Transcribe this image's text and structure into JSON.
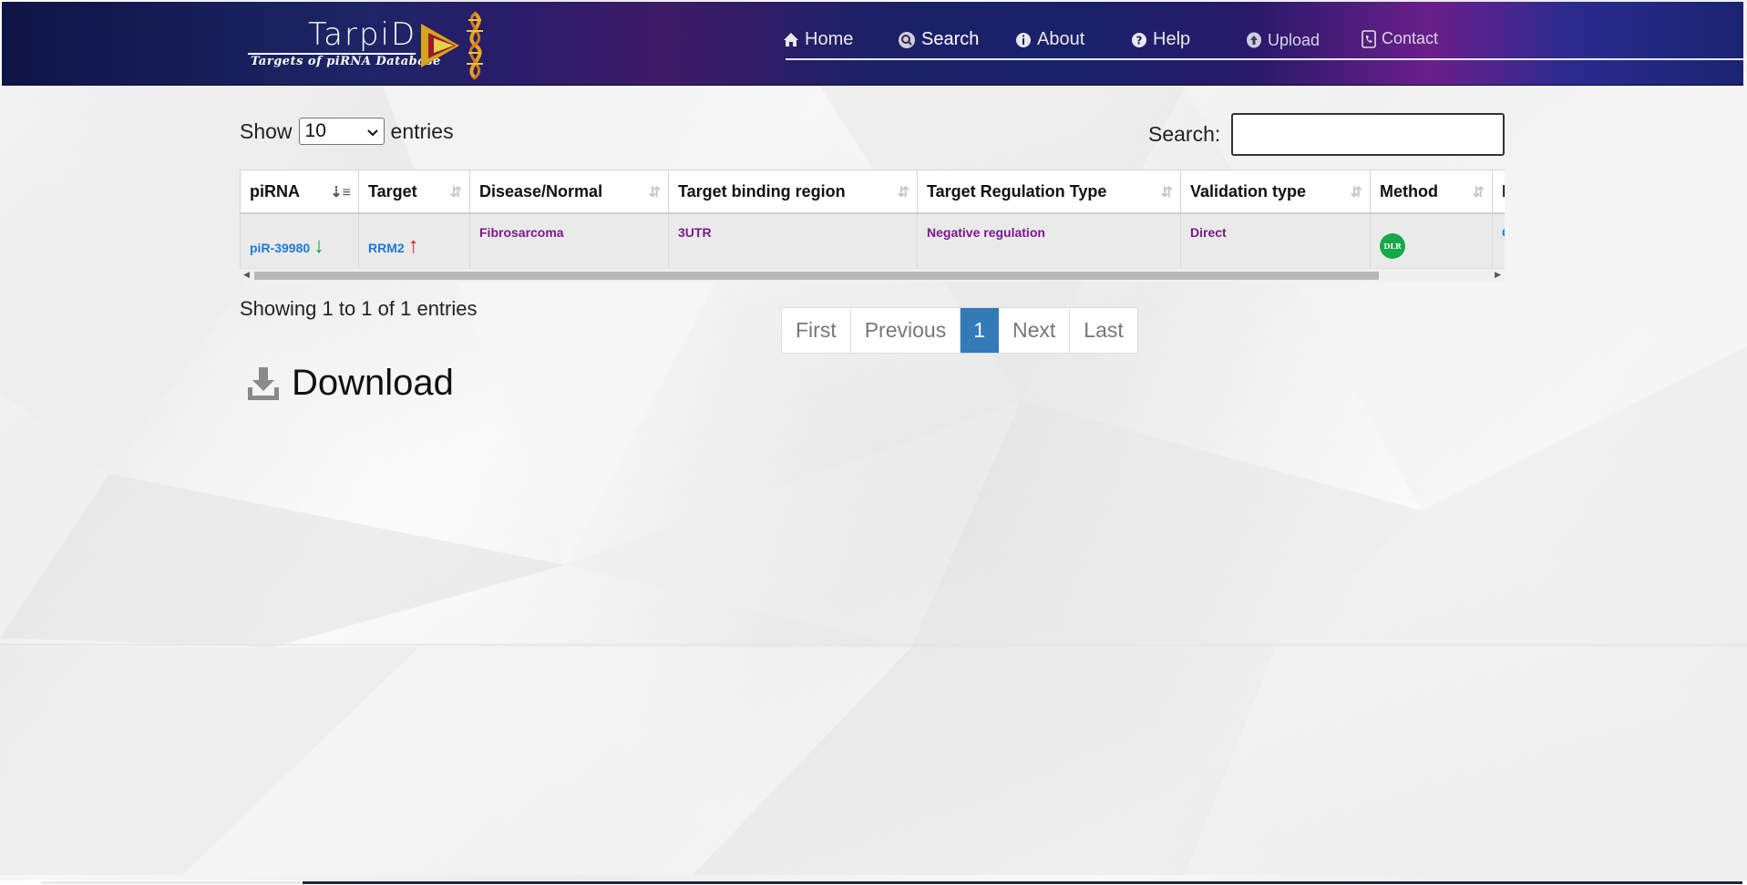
{
  "header": {
    "logo_title": "TarpiD",
    "logo_subtitle": "Targets of piRNA Database",
    "colors": {
      "bg_start": "#0f1446",
      "bg_accent": "#6a1f8a"
    }
  },
  "nav": {
    "home": {
      "label": "Home",
      "icon": "home-icon"
    },
    "search": {
      "label": "Search",
      "icon": "search-icon"
    },
    "about": {
      "label": "About",
      "icon": "info-icon"
    },
    "help": {
      "label": "Help",
      "icon": "question-icon"
    },
    "upload": {
      "label": "Upload",
      "icon": "upload-icon"
    },
    "contact": {
      "label": "Contact",
      "icon": "phone-icon"
    }
  },
  "length_control": {
    "prefix": "Show",
    "selected": "10",
    "suffix": "entries"
  },
  "search": {
    "label": "Search:",
    "value": ""
  },
  "table": {
    "columns": [
      "piRNA",
      "Target",
      "Disease/Normal",
      "Target binding region",
      "Target Regulation Type",
      "Validation type",
      "Method",
      "I"
    ],
    "sorted_column": "piRNA",
    "rows": [
      {
        "pirna": "piR-39980",
        "pirna_arrow": "↓",
        "target": "RRM2",
        "target_arrow": "↑",
        "disease": "Fibrosarcoma",
        "binding_region": "3UTR",
        "regulation_type": "Negative regulation",
        "validation_type": "Direct",
        "method": "DLR",
        "extra": "C"
      }
    ]
  },
  "info": {
    "text": "Showing 1 to 1 of 1 entries"
  },
  "pagination": {
    "first": "First",
    "previous": "Previous",
    "current": "1",
    "next": "Next",
    "last": "Last",
    "active_color": "#337ab7"
  },
  "download": {
    "label": "Download",
    "icon": "download-icon"
  }
}
